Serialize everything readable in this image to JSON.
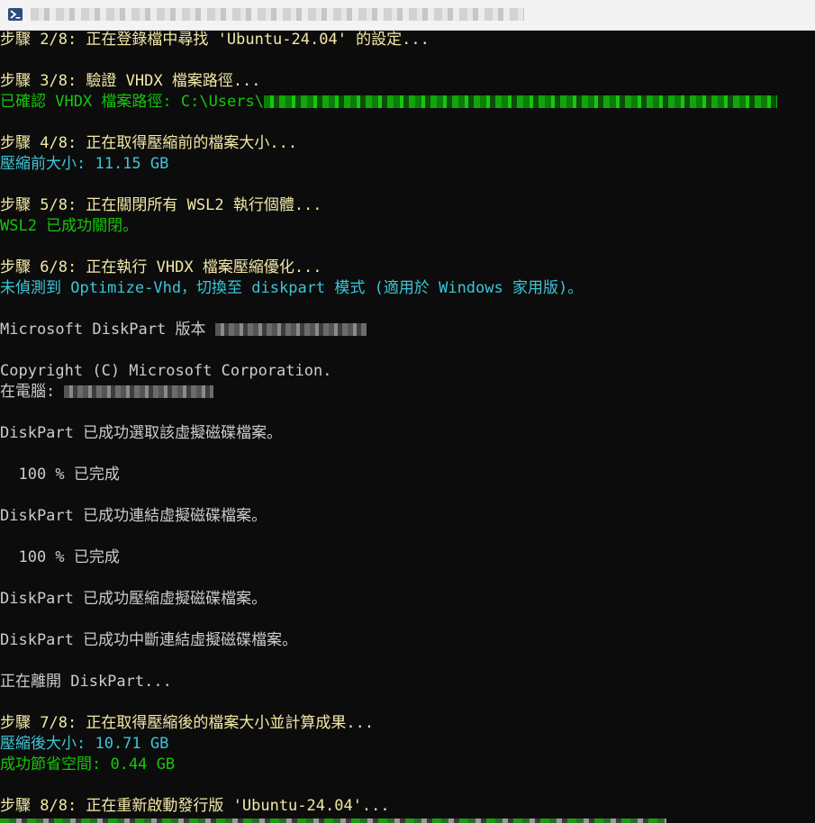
{
  "window": {
    "icon": "powershell-icon"
  },
  "lines": {
    "step2": "步驟 2/8: 正在登錄檔中尋找 'Ubuntu-24.04' 的設定...",
    "step3": "步驟 3/8: 驗證 VHDX 檔案路徑...",
    "step3_result": "已確認 VHDX 檔案路徑: C:\\Users\\",
    "step4": "步驟 4/8: 正在取得壓縮前的檔案大小...",
    "step4_result": "壓縮前大小: 11.15 GB",
    "step5": "步驟 5/8: 正在關閉所有 WSL2 執行個體...",
    "step5_result": "WSL2 已成功關閉。",
    "step6": "步驟 6/8: 正在執行 VHDX 檔案壓縮優化...",
    "step6_result": "未偵測到 Optimize-Vhd，切換至 diskpart 模式 (適用於 Windows 家用版)。",
    "diskpart_version": "Microsoft DiskPart 版本 ",
    "copyright": "Copyright (C) Microsoft Corporation.",
    "computer": "在電腦: ",
    "select": "DiskPart 已成功選取該虛擬磁碟檔案。",
    "progress1": "  100 % 已完成",
    "attach": "DiskPart 已成功連結虛擬磁碟檔案。",
    "progress2": "  100 % 已完成",
    "compact": "DiskPart 已成功壓縮虛擬磁碟檔案。",
    "detach": "DiskPart 已成功中斷連結虛擬磁碟檔案。",
    "leaving": "正在離開 DiskPart...",
    "step7": "步驟 7/8: 正在取得壓縮後的檔案大小並計算成果...",
    "step7_after": "壓縮後大小: 10.71 GB",
    "step7_saved": "成功節省空間: 0.44 GB",
    "step8": "步驟 8/8: 正在重新啟動發行版 'Ubuntu-24.04'..."
  },
  "colors": {
    "background": "#0c0c0c",
    "step": "#f2e9a6",
    "success": "#16c60c",
    "info": "#3bc6d8",
    "plain": "#cccccc"
  }
}
